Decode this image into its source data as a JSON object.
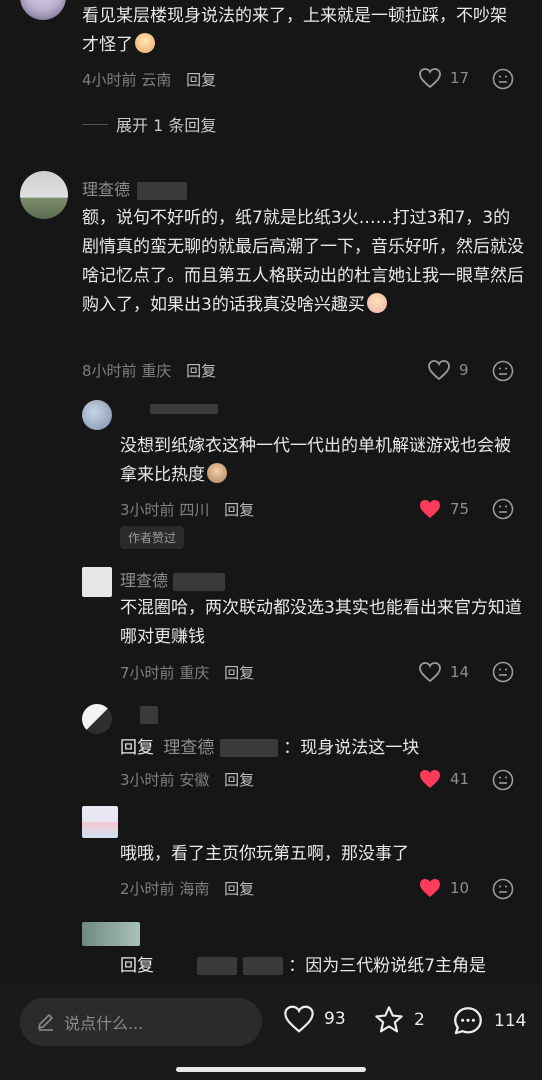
{
  "comments": [
    {
      "text": "看见某层楼现身说法的来了，上来就是一顿拉踩，不吵架才怪了",
      "time": "4小时前",
      "location": "云南",
      "reply_label": "回复",
      "likes": "17",
      "liked": false
    },
    {
      "name": "理查德",
      "text": "额，说句不好听的，纸7就是比纸3火……打过3和7，3的剧情真的蛮无聊的就最后高潮了一下，音乐好听，然后就没啥记忆点了。而且第五人格联动出的杜言她让我一眼草然后购入了，如果出3的话我真没啥兴趣买",
      "time": "8小时前",
      "location": "重庆",
      "reply_label": "回复",
      "likes": "9",
      "liked": false
    }
  ],
  "expand_label": "展开 1 条回复",
  "replies": [
    {
      "text": "没想到纸嫁衣这种一代一代出的单机解谜游戏也会被拿来比热度",
      "time": "3小时前",
      "location": "四川",
      "reply_label": "回复",
      "likes": "75",
      "liked": true,
      "badge": "作者赞过"
    },
    {
      "name": "理查德",
      "text": "不混圈哈，两次联动都没选3其实也能看出来官方知道哪对更赚钱",
      "time": "7小时前",
      "location": "重庆",
      "reply_label": "回复",
      "likes": "14",
      "liked": false
    },
    {
      "reply_prefix": "回复",
      "reply_to": "理查德",
      "text": "：现身说法这一块",
      "time": "3小时前",
      "location": "安徽",
      "reply_label": "回复",
      "likes": "41",
      "liked": true
    },
    {
      "text": "哦哦，看了主页你玩第五啊，那没事了",
      "time": "2小时前",
      "location": "海南",
      "reply_label": "回复",
      "likes": "10",
      "liked": true
    },
    {
      "reply_prefix": "回复",
      "text": "：因为三代粉说纸7主角是"
    }
  ],
  "bottom_bar": {
    "input_placeholder": "说点什么...",
    "like_count": "93",
    "star_count": "2",
    "comment_count": "114"
  },
  "colors": {
    "background": "#161616",
    "liked_heart": "#ff3b5c"
  }
}
